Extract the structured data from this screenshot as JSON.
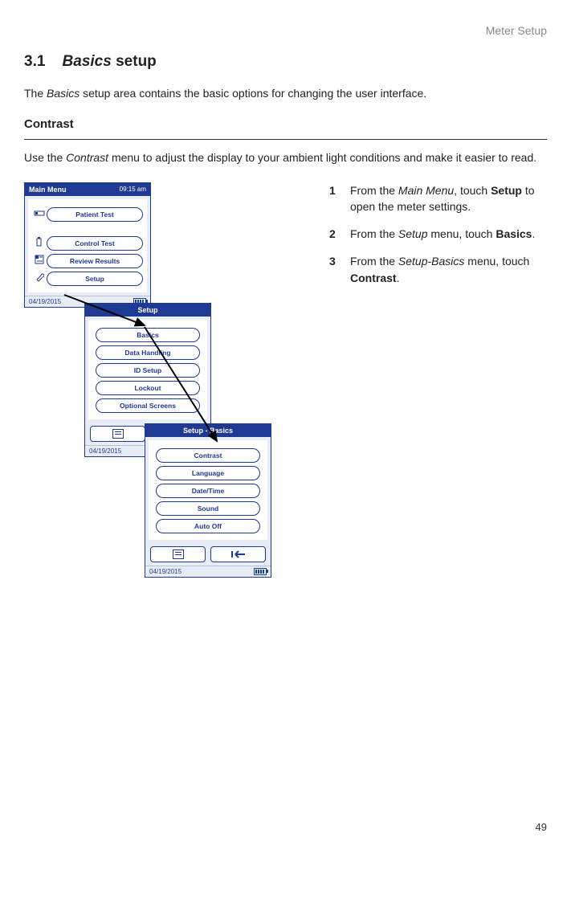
{
  "header": {
    "page_label": "Meter Setup"
  },
  "section": {
    "number": "3.1",
    "title_italic": "Basics",
    "title_rest": " setup",
    "intro_pre": "The ",
    "intro_italic": "Basics",
    "intro_post": " setup area contains the basic options for changing the user interface."
  },
  "contrast": {
    "heading": "Contrast",
    "desc_pre": "Use the ",
    "desc_italic": "Contrast",
    "desc_post": " menu to adjust the display to your ambient light conditions and make it easier to read."
  },
  "steps": [
    {
      "num": "1",
      "pre": "From the ",
      "i1": "Main Menu",
      "mid": ", touch ",
      "b": "Setup",
      "post": " to open the meter settings."
    },
    {
      "num": "2",
      "pre": "From the ",
      "i1": "Setup",
      "mid": " menu, touch ",
      "b": "Basics",
      "post": "."
    },
    {
      "num": "3",
      "pre": "From the ",
      "i1": "Setup-Basics",
      "mid": " menu, touch ",
      "b": "Contrast",
      "post": "."
    }
  ],
  "screens": {
    "main": {
      "title": "Main Menu",
      "time": "09:15 am",
      "items": [
        "Patient Test",
        "Control Test",
        "Review Results",
        "Setup"
      ],
      "date": "04/19/2015"
    },
    "setup": {
      "title": "Setup",
      "items": [
        "Basics",
        "Data Handling",
        "ID Setup",
        "Lockout",
        "Optional Screens"
      ],
      "date": "04/19/2015"
    },
    "basics": {
      "title": "Setup - Basics",
      "items": [
        "Contrast",
        "Language",
        "Date/Time",
        "Sound",
        "Auto Off"
      ],
      "date": "04/19/2015"
    }
  },
  "page_number": "49"
}
